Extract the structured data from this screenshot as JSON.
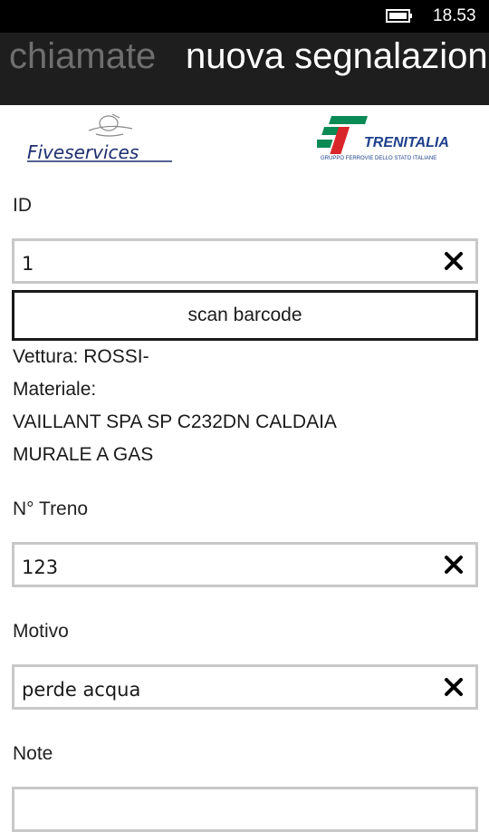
{
  "status_bar": {
    "time": "18.53",
    "battery_icon": "battery-icon"
  },
  "pivot": {
    "previous": "chiamate",
    "current": "nuova segnalazione"
  },
  "logos": {
    "left": {
      "name": "Fiveservices"
    },
    "right": {
      "name": "TRENITALIA",
      "tagline": "GRUPPO FERROVIE DELLO STATO ITALIANE"
    }
  },
  "form": {
    "id": {
      "label": "ID",
      "value": "1"
    },
    "scan_button_label": "scan barcode",
    "info_lines": [
      "Vettura: ROSSI-",
      "Materiale:",
      "VAILLANT SPA SP C232DN  CALDAIA",
      "MURALE A GAS"
    ],
    "treno": {
      "label": "N° Treno",
      "value": "123"
    },
    "motivo": {
      "label": "Motivo",
      "value": "perde acqua"
    },
    "note": {
      "label": "Note",
      "value": ""
    }
  },
  "colors": {
    "header_bg": "#1e1e1e",
    "pivot_inactive": "#6f6f6f",
    "textbox_border": "#c8c8c8",
    "trenitalia_green": "#0a8a55",
    "trenitalia_red": "#d9262a",
    "trenitalia_blue": "#1f3f8a"
  }
}
